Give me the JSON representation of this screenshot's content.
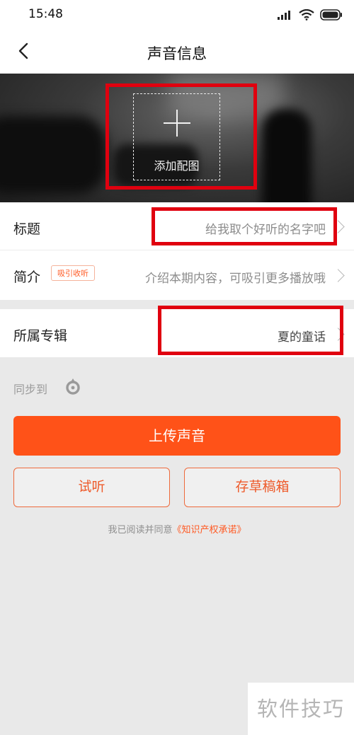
{
  "status_bar": {
    "time": "15:48"
  },
  "header": {
    "title": "声音信息"
  },
  "cover": {
    "add_label": "添加配图"
  },
  "form": {
    "title_row": {
      "label": "标题",
      "placeholder": "给我取个好听的名字吧"
    },
    "intro_row": {
      "label": "简介",
      "badge": "吸引收听",
      "placeholder": "介绍本期内容，可吸引更多播放哦"
    },
    "album_row": {
      "label": "所属专辑",
      "value": "夏的童话"
    }
  },
  "sync": {
    "label": "同步到"
  },
  "actions": {
    "upload_label": "上传声音",
    "preview_label": "试听",
    "draft_label": "存草稿箱"
  },
  "agreement": {
    "text": "我已阅读并同意",
    "link": "《知识产权承诺》"
  },
  "watermark": {
    "text": "软件技巧"
  },
  "colors": {
    "accent": "#ff5218",
    "highlight_box": "#e0000f"
  }
}
